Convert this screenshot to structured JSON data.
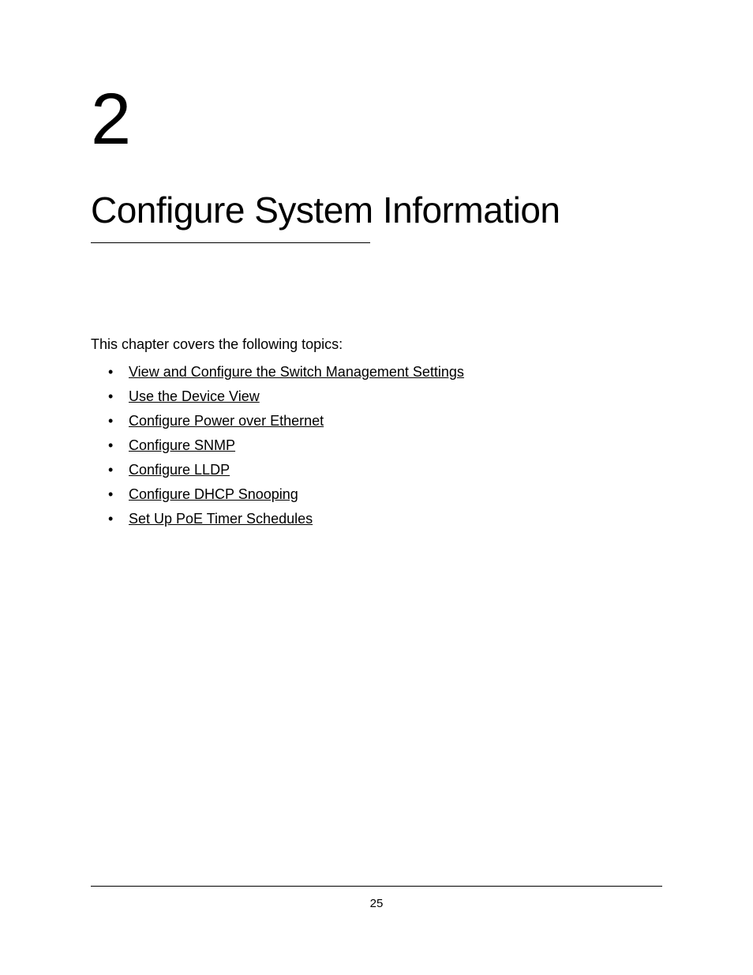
{
  "chapter": {
    "number": "2",
    "title": "Configure System Information"
  },
  "intro": "This chapter covers the following topics:",
  "topics": [
    "View and Configure the Switch Management Settings",
    "Use the Device View",
    "Configure Power over Ethernet",
    "Configure SNMP",
    "Configure LLDP",
    "Configure DHCP Snooping",
    "Set Up PoE Timer Schedules"
  ],
  "page_number": "25"
}
